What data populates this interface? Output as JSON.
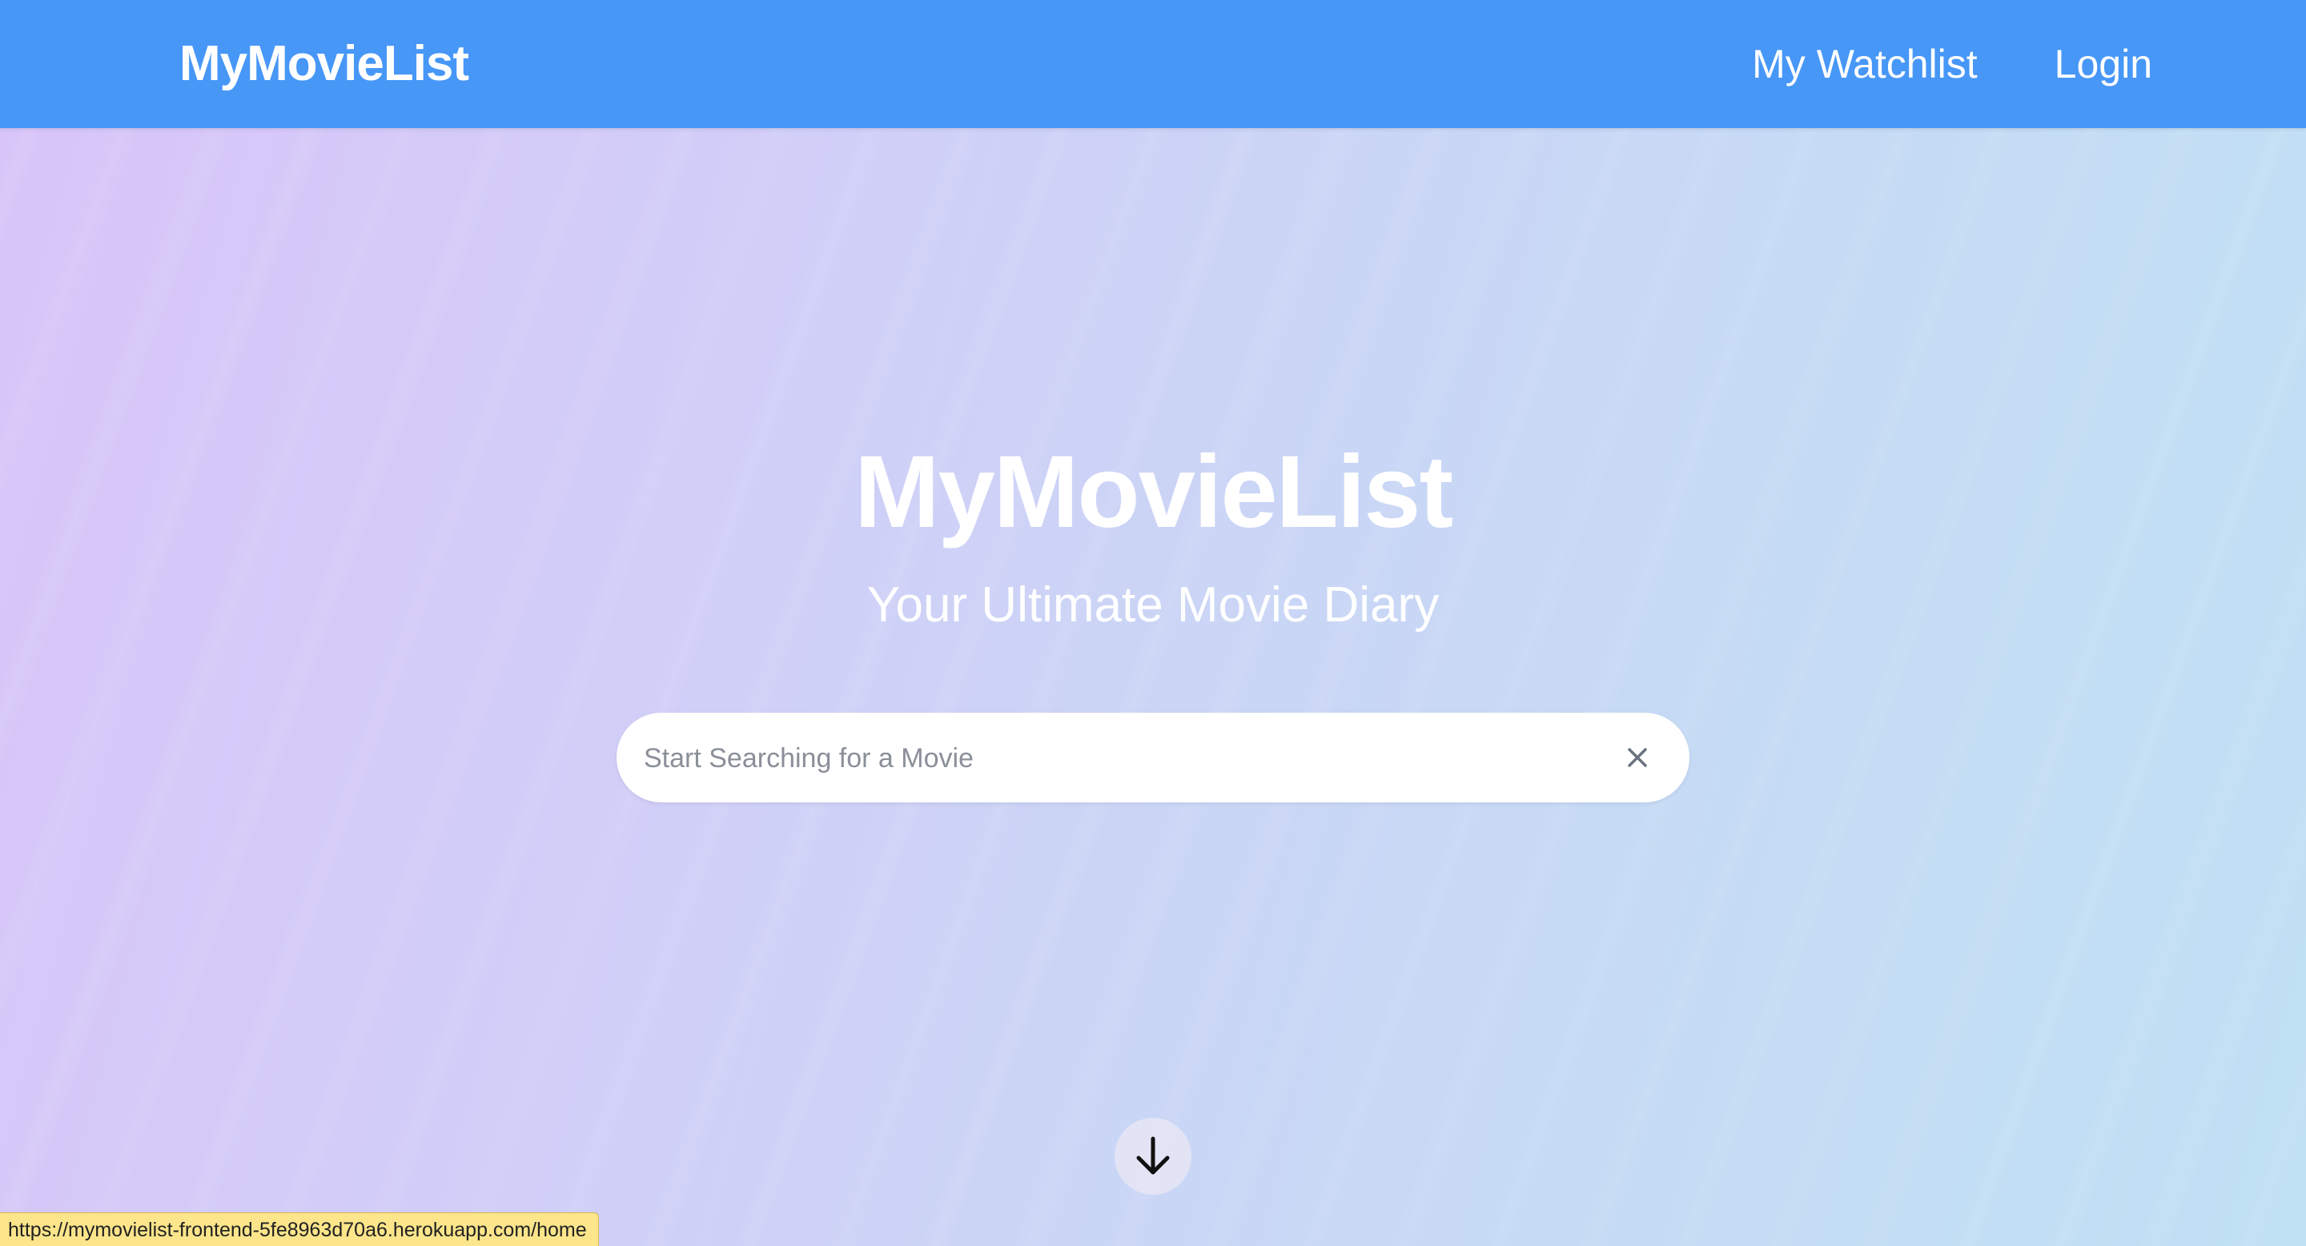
{
  "navbar": {
    "brand": "MyMovieList",
    "links": [
      {
        "label": "My Watchlist"
      },
      {
        "label": "Login"
      }
    ],
    "background_color": "#4797f7"
  },
  "hero": {
    "title": "MyMovieList",
    "subtitle": "Your Ultimate Movie Diary"
  },
  "search": {
    "placeholder": "Start Searching for a Movie",
    "value": "",
    "clear_icon": "close-icon"
  },
  "scroll_button": {
    "icon": "arrow-down-icon"
  },
  "status_bar": {
    "url": "https://mymovielist-frontend-5fe8963d70a6.herokuapp.com/home"
  }
}
